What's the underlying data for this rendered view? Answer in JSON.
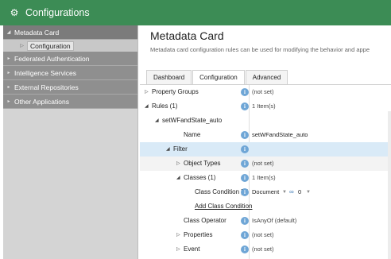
{
  "window": {
    "title": "Configurations",
    "icon": "gear-icon"
  },
  "sidebar": {
    "items": [
      {
        "label": "Metadata Card",
        "expanded": true,
        "children": [
          {
            "label": "Configuration",
            "selected": true
          }
        ]
      },
      {
        "label": "Federated Authentication"
      },
      {
        "label": "Intelligence Services"
      },
      {
        "label": "External Repositories"
      },
      {
        "label": "Other Applications"
      }
    ]
  },
  "main": {
    "title": "Metadata Card",
    "description": "Metadata card configuration rules can be used for modifying the behavior and appe",
    "tabs": [
      {
        "label": "Dashboard",
        "active": false
      },
      {
        "label": "Configuration",
        "active": true
      },
      {
        "label": "Advanced",
        "active": false
      }
    ],
    "rows": [
      {
        "name": "Property Groups",
        "value": "(not set)"
      },
      {
        "name": "Rules (1)",
        "value": "1 Item(s)"
      },
      {
        "name": "setWFandState_auto",
        "value": ""
      },
      {
        "name": "Name",
        "value": "setWFandState_auto"
      },
      {
        "name": "Filter",
        "value": ""
      },
      {
        "name": "Object Types",
        "value": "(not set)"
      },
      {
        "name": "Classes (1)",
        "value": "1 Item(s)"
      },
      {
        "name": "Class Condition [1]",
        "value": "Document",
        "link_glyph": "∞",
        "count": "0"
      },
      {
        "name": "Add Class Condition",
        "value": ""
      },
      {
        "name": "Class Operator",
        "value": "IsAnyOf (default)"
      },
      {
        "name": "Properties",
        "value": "(not set)"
      },
      {
        "name": "Event",
        "value": "(not set)"
      }
    ]
  },
  "colors": {
    "titlebar": "#3c8c55",
    "sidebar_item": "#8f8f8f",
    "selected_row": "#d9eaf7",
    "info_icon": "#6fa6d6"
  }
}
